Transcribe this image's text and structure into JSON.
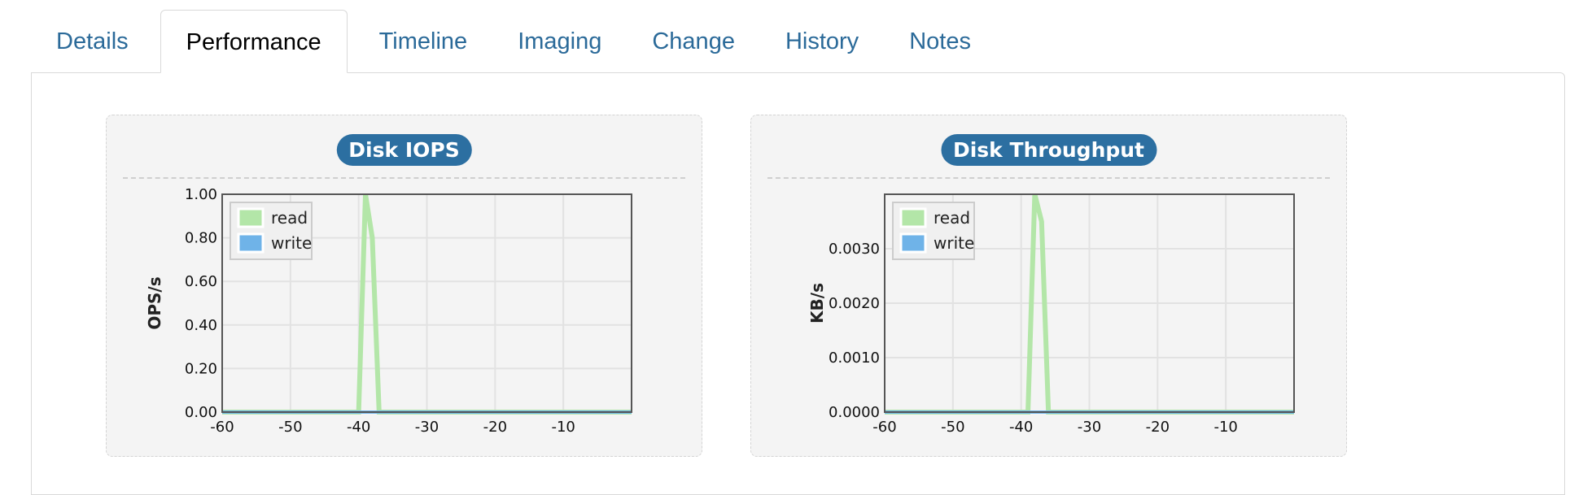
{
  "tabs": [
    {
      "label": "Details",
      "active": false
    },
    {
      "label": "Performance",
      "active": true
    },
    {
      "label": "Timeline",
      "active": false
    },
    {
      "label": "Imaging",
      "active": false
    },
    {
      "label": "Change",
      "active": false
    },
    {
      "label": "History",
      "active": false
    },
    {
      "label": "Notes",
      "active": false
    }
  ],
  "colors": {
    "tab_link": "#2b6a99",
    "badge": "#2c6fa1",
    "read": "#b3e6a8",
    "write": "#6fb3e8"
  },
  "chart_data": [
    {
      "type": "line",
      "title": "Disk IOPS",
      "ylabel": "OPS/s",
      "xlabel": "",
      "xlim": [
        -60,
        0
      ],
      "ylim": [
        0,
        1.0
      ],
      "xticks": [
        "-60",
        "-50",
        "-40",
        "-30",
        "-20",
        "-10"
      ],
      "xtick_values": [
        -60,
        -50,
        -40,
        -30,
        -20,
        -10
      ],
      "yticks": [
        "0.00",
        "0.20",
        "0.40",
        "0.60",
        "0.80",
        "1.00"
      ],
      "ytick_values": [
        0,
        0.2,
        0.4,
        0.6,
        0.8,
        1.0
      ],
      "grid": true,
      "legend_position": "top-left",
      "series": [
        {
          "name": "read",
          "x": [
            -60,
            -40,
            -39,
            -38,
            -37,
            0
          ],
          "y": [
            0,
            0,
            1.0,
            0.8,
            0,
            0
          ]
        },
        {
          "name": "write",
          "x": [
            -60,
            0
          ],
          "y": [
            0,
            0
          ]
        }
      ]
    },
    {
      "type": "line",
      "title": "Disk Throughput",
      "ylabel": "KB/s",
      "xlabel": "",
      "xlim": [
        -60,
        0
      ],
      "ylim": [
        0,
        0.004
      ],
      "xticks": [
        "-60",
        "-50",
        "-40",
        "-30",
        "-20",
        "-10"
      ],
      "xtick_values": [
        -60,
        -50,
        -40,
        -30,
        -20,
        -10
      ],
      "yticks": [
        "0.0000",
        "0.0010",
        "0.0020",
        "0.0030"
      ],
      "ytick_values": [
        0,
        0.001,
        0.002,
        0.003
      ],
      "grid": true,
      "legend_position": "top-left",
      "series": [
        {
          "name": "read",
          "x": [
            -60,
            -39,
            -38,
            -37,
            -36,
            0
          ],
          "y": [
            0,
            0,
            0.004,
            0.0035,
            0,
            0
          ]
        },
        {
          "name": "write",
          "x": [
            -60,
            0
          ],
          "y": [
            0,
            0
          ]
        }
      ]
    }
  ]
}
